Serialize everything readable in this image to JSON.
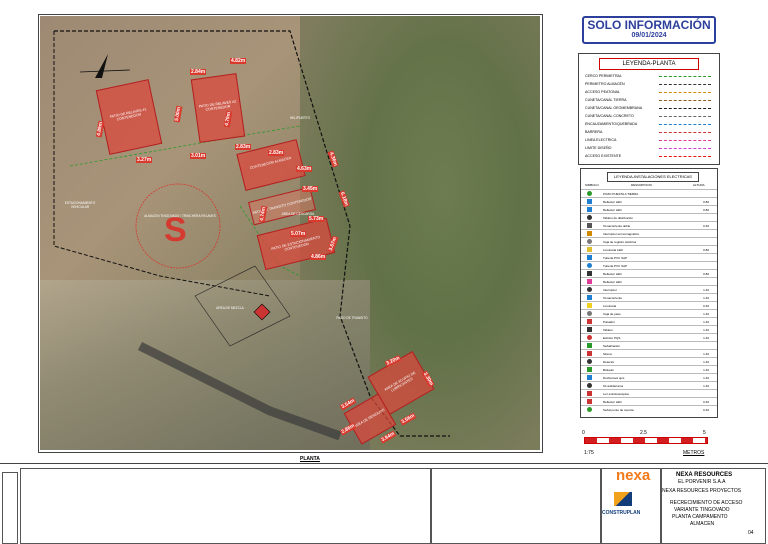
{
  "stamp": {
    "title": "SOLO INFORMACIÓN",
    "date": "09/01/2024"
  },
  "legend_planta": {
    "title": "LEYENDA-PLANTA",
    "items": [
      {
        "label": "CERCO PERIMETRAL",
        "color": "#2a9a2a"
      },
      {
        "label": "PERIMETRO ALMACÉN",
        "color": "#333333"
      },
      {
        "label": "ACCESO PEATONAL",
        "color": "#d08a00"
      },
      {
        "label": "CUNETA/CANAL TIERRA",
        "color": "#8a5a20"
      },
      {
        "label": "CUNETA/CANAL GEOMEMBRANA",
        "color": "#1a1a1a"
      },
      {
        "label": "CUNETA/CANAL CONCRETO",
        "color": "#666666"
      },
      {
        "label": "ENCAUZAMIENTO/QUEBRADA",
        "color": "#1f7fd0"
      },
      {
        "label": "BARRERA",
        "color": "#c83232"
      },
      {
        "label": "LINEA ELECTRICA",
        "color": "#e03a9a"
      },
      {
        "label": "LIMITE DISEÑO",
        "color": "#d040d0"
      },
      {
        "label": "ACCESO EXISTENTE",
        "color": "#e81010"
      }
    ]
  },
  "legend_electricas": {
    "title": "LEYENDA-INSTALACIONES ELECTRICAS",
    "col_symbol": "SIMBOLO",
    "col_desc": "DESCRIPCION",
    "col_val": "ALTURA",
    "rows": [
      {
        "desc": "POZO PUESTA A TIERRA",
        "val": ""
      },
      {
        "desc": "Reflector LED",
        "val": "0.80"
      },
      {
        "desc": "Reflector LED",
        "val": "0.80"
      },
      {
        "desc": "Tablero de distribución",
        "val": ""
      },
      {
        "desc": "Tomacorriente doble",
        "val": "0.40"
      },
      {
        "desc": "Interruptor termomagnético",
        "val": ""
      },
      {
        "desc": "Caja de registro eléctrica",
        "val": ""
      },
      {
        "desc": "Luminaria LED",
        "val": "0.80"
      },
      {
        "desc": "Tubería PVC SAP",
        "val": ""
      },
      {
        "desc": "Tubería PVC SAP",
        "val": ""
      },
      {
        "desc": "Reflector LED",
        "val": "0.80"
      },
      {
        "desc": "Reflector LED",
        "val": ""
      },
      {
        "desc": "Interruptor",
        "val": "1.40"
      },
      {
        "desc": "Tomacorriente",
        "val": "1.40"
      },
      {
        "desc": "Luminaria",
        "val": "0.40"
      },
      {
        "desc": "Caja de paso",
        "val": "1.40"
      },
      {
        "desc": "Pulsador",
        "val": "1.40"
      },
      {
        "desc": "Tablero",
        "val": "1.40"
      },
      {
        "desc": "Extintor PQS",
        "val": "1.40"
      },
      {
        "desc": "Señalización",
        "val": ""
      },
      {
        "desc": "Sirena",
        "val": "1.40"
      },
      {
        "desc": "Detector",
        "val": "1.40"
      },
      {
        "desc": "Botiquín",
        "val": "1.40"
      },
      {
        "desc": "Ducha lava ojos",
        "val": "1.40"
      },
      {
        "desc": "Kit antiderrame",
        "val": "1.40"
      },
      {
        "desc": "Luz estroboscópica",
        "val": ""
      },
      {
        "desc": "Reflector LED",
        "val": "0.40"
      },
      {
        "desc": "Señal punto de reunión",
        "val": "0.40"
      }
    ]
  },
  "scale": {
    "ticks": [
      "0",
      "2.5",
      "5"
    ],
    "ratio": "1:75",
    "unit": "METROS"
  },
  "map": {
    "plan_label": "PLANTA",
    "buildings": [
      {
        "label": "PATIO DE RELAVES #1 CONTENEDOR"
      },
      {
        "label": "PATIO DE RELAVES #2 CONTENEDOR"
      },
      {
        "label": "CONTENEDOR ALMACEN"
      },
      {
        "label": "PATIO DE TRANSITO CONTENEDOR"
      },
      {
        "label": "PATIO DE ESTACIONAMIENTO CONTENEDOR"
      },
      {
        "label": "AREA DE ACOPIO DE LUBRICANTES"
      },
      {
        "label": "AREA DE RESIDUOS"
      }
    ],
    "dims": [
      "4.89m",
      "2.84m",
      "4.82m",
      "5.00m",
      "4.79m",
      "3.27m",
      "3.01m",
      "2.83m",
      "2.83m",
      "4.63m",
      "3.45m",
      "5.73m",
      "4.74m",
      "5.07m",
      "3.67m",
      "4.86m",
      "4.36m",
      "6.18m",
      "3.20m",
      "3.30m",
      "3.54m",
      "3.56m",
      "2.86m",
      "3.94m"
    ],
    "labels": [
      "ESTACIONAMIENTO VEHICULAR",
      "ALMACEN TINGOVADO / TRINCHERA RELAVES",
      "AREA DE MEZCLA",
      "PATIO DE TRANSITO",
      "HELIPUERTO",
      "AREA DE DESCARGA"
    ]
  },
  "title_block": {
    "company1": "NEXA RESOURCES",
    "company2": "EL PORVENIR S.A.A",
    "dept": "NEXA RESOURCES PROYECTOS",
    "project1": "RECRECIMIENTO DE ACCESO",
    "project2": "VARIANTE TINGOVADO",
    "project3": "PLANTA CAMPAMENTO",
    "project4": "ALMACEN",
    "logo_nexa": "nexa",
    "logo_constru": "CONSTRUPLAN",
    "sheet_no": "04"
  }
}
